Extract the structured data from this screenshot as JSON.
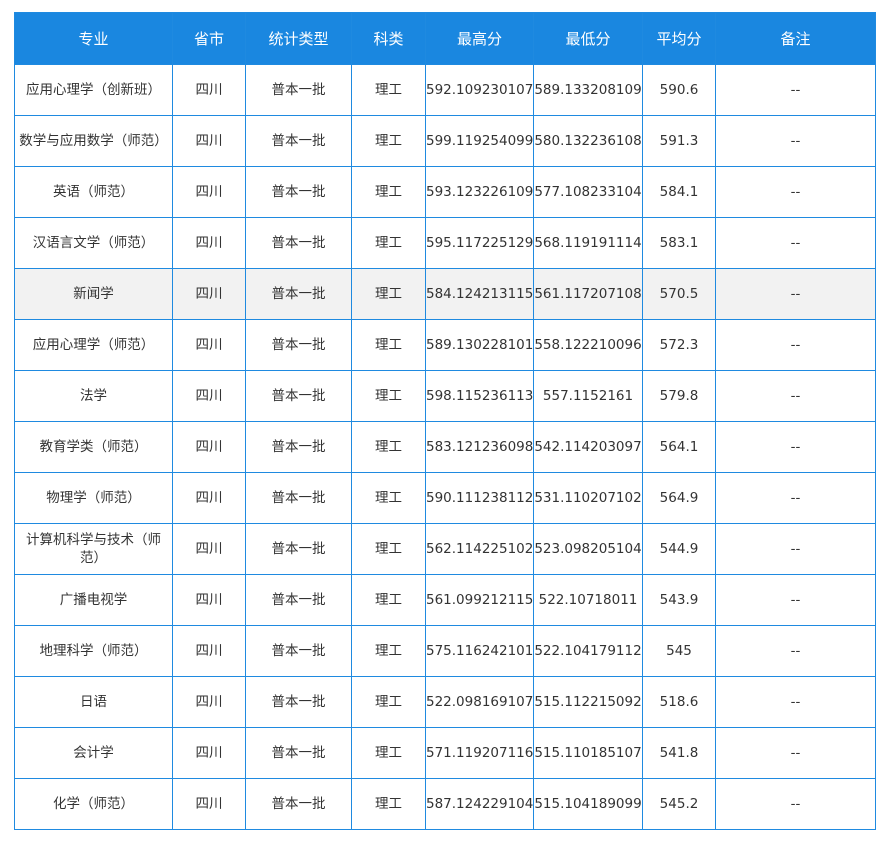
{
  "table": {
    "headers": [
      "专业",
      "省市",
      "统计类型",
      "科类",
      "最高分",
      "最低分",
      "平均分",
      "备注"
    ],
    "rows": [
      [
        "应用心理学（创新班）",
        "四川",
        "普本一批",
        "理工",
        "592.109230107",
        "589.133208109",
        "590.6",
        "--"
      ],
      [
        "数学与应用数学（师范）",
        "四川",
        "普本一批",
        "理工",
        "599.119254099",
        "580.132236108",
        "591.3",
        "--"
      ],
      [
        "英语（师范）",
        "四川",
        "普本一批",
        "理工",
        "593.123226109",
        "577.108233104",
        "584.1",
        "--"
      ],
      [
        "汉语言文学（师范）",
        "四川",
        "普本一批",
        "理工",
        "595.117225129",
        "568.119191114",
        "583.1",
        "--"
      ],
      [
        "新闻学",
        "四川",
        "普本一批",
        "理工",
        "584.124213115",
        "561.117207108",
        "570.5",
        "--"
      ],
      [
        "应用心理学（师范）",
        "四川",
        "普本一批",
        "理工",
        "589.130228101",
        "558.122210096",
        "572.3",
        "--"
      ],
      [
        "法学",
        "四川",
        "普本一批",
        "理工",
        "598.115236113",
        "557.1152161",
        "579.8",
        "--"
      ],
      [
        "教育学类（师范）",
        "四川",
        "普本一批",
        "理工",
        "583.121236098",
        "542.114203097",
        "564.1",
        "--"
      ],
      [
        "物理学（师范）",
        "四川",
        "普本一批",
        "理工",
        "590.111238112",
        "531.110207102",
        "564.9",
        "--"
      ],
      [
        "计算机科学与技术（师范）",
        "四川",
        "普本一批",
        "理工",
        "562.114225102",
        "523.098205104",
        "544.9",
        "--"
      ],
      [
        "广播电视学",
        "四川",
        "普本一批",
        "理工",
        "561.099212115",
        "522.10718011",
        "543.9",
        "--"
      ],
      [
        "地理科学（师范）",
        "四川",
        "普本一批",
        "理工",
        "575.116242101",
        "522.104179112",
        "545",
        "--"
      ],
      [
        "日语",
        "四川",
        "普本一批",
        "理工",
        "522.098169107",
        "515.112215092",
        "518.6",
        "--"
      ],
      [
        "会计学",
        "四川",
        "普本一批",
        "理工",
        "571.119207116",
        "515.110185107",
        "541.8",
        "--"
      ],
      [
        "化学（师范）",
        "四川",
        "普本一批",
        "理工",
        "587.124229104",
        "515.104189099",
        "545.2",
        "--"
      ]
    ]
  }
}
